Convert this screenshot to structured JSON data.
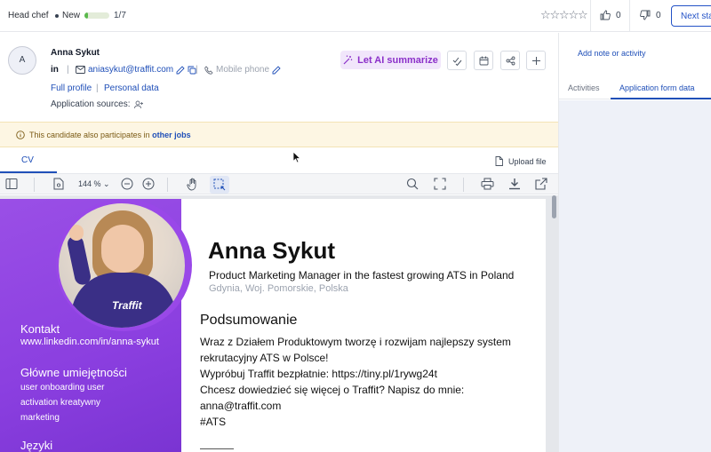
{
  "topbar": {
    "job_title": "Head chef",
    "stage_label": "New",
    "stage_progress": 0.143,
    "stage_count": "1/7",
    "rating_stars": 5,
    "likes": "0",
    "dislikes": "0",
    "next_stage_label": "Next stage"
  },
  "candidate": {
    "avatar_initial": "A",
    "name": "Anna Sykut",
    "linkedin_label": "in",
    "email": "aniasykut@traffit.com",
    "phone_placeholder": "Mobile phone",
    "full_profile_label": "Full profile",
    "personal_data_label": "Personal data",
    "application_sources_label": "Application sources:"
  },
  "actions": {
    "ai_summarize_label": "Let AI summarize"
  },
  "alert": {
    "text": "This candidate also participates in",
    "link": "other jobs"
  },
  "cv_tabs": {
    "cv_label": "CV",
    "upload_label": "Upload file"
  },
  "viewer": {
    "zoom": "144 %"
  },
  "right_panel": {
    "add_note_label": "Add note or activity",
    "tab_activities": "Activities",
    "tab_application_form": "Application form data"
  },
  "cv_document": {
    "name": "Anna Sykut",
    "headline": "Product Marketing Manager in the fastest growing ATS in Poland",
    "location": "Gdynia, Woj. Pomorskie, Polska",
    "summary_heading": "Podsumowanie",
    "summary_lines": [
      "Wraz z Działem Produktowym tworzę i rozwijam najlepszy system",
      "rekrutacyjny ATS w Polsce!",
      "Wypróbuj Traffit bezpłatnie: https://tiny.pl/1rywg24t",
      "Chcesz dowiedzieć się więcej o Traffit? Napisz do mnie:",
      "anna@traffit.com",
      "#ATS"
    ],
    "photo_brand_text": "Traffit",
    "contact_heading": "Kontakt",
    "contact_linkedin": "www.linkedin.com/in/anna-sykut",
    "skills_heading": "Główne umiejętności",
    "skills": [
      "user onboarding user",
      "activation kreatywny",
      "marketing"
    ],
    "languages_heading": "Języki"
  },
  "colors": {
    "accent_blue": "#1f4fb8",
    "ai_purple": "#8b2fc9",
    "cv_purple": "#8b3fe0",
    "progress_green": "#5ab94c",
    "alert_bg": "#fdf6e3"
  }
}
